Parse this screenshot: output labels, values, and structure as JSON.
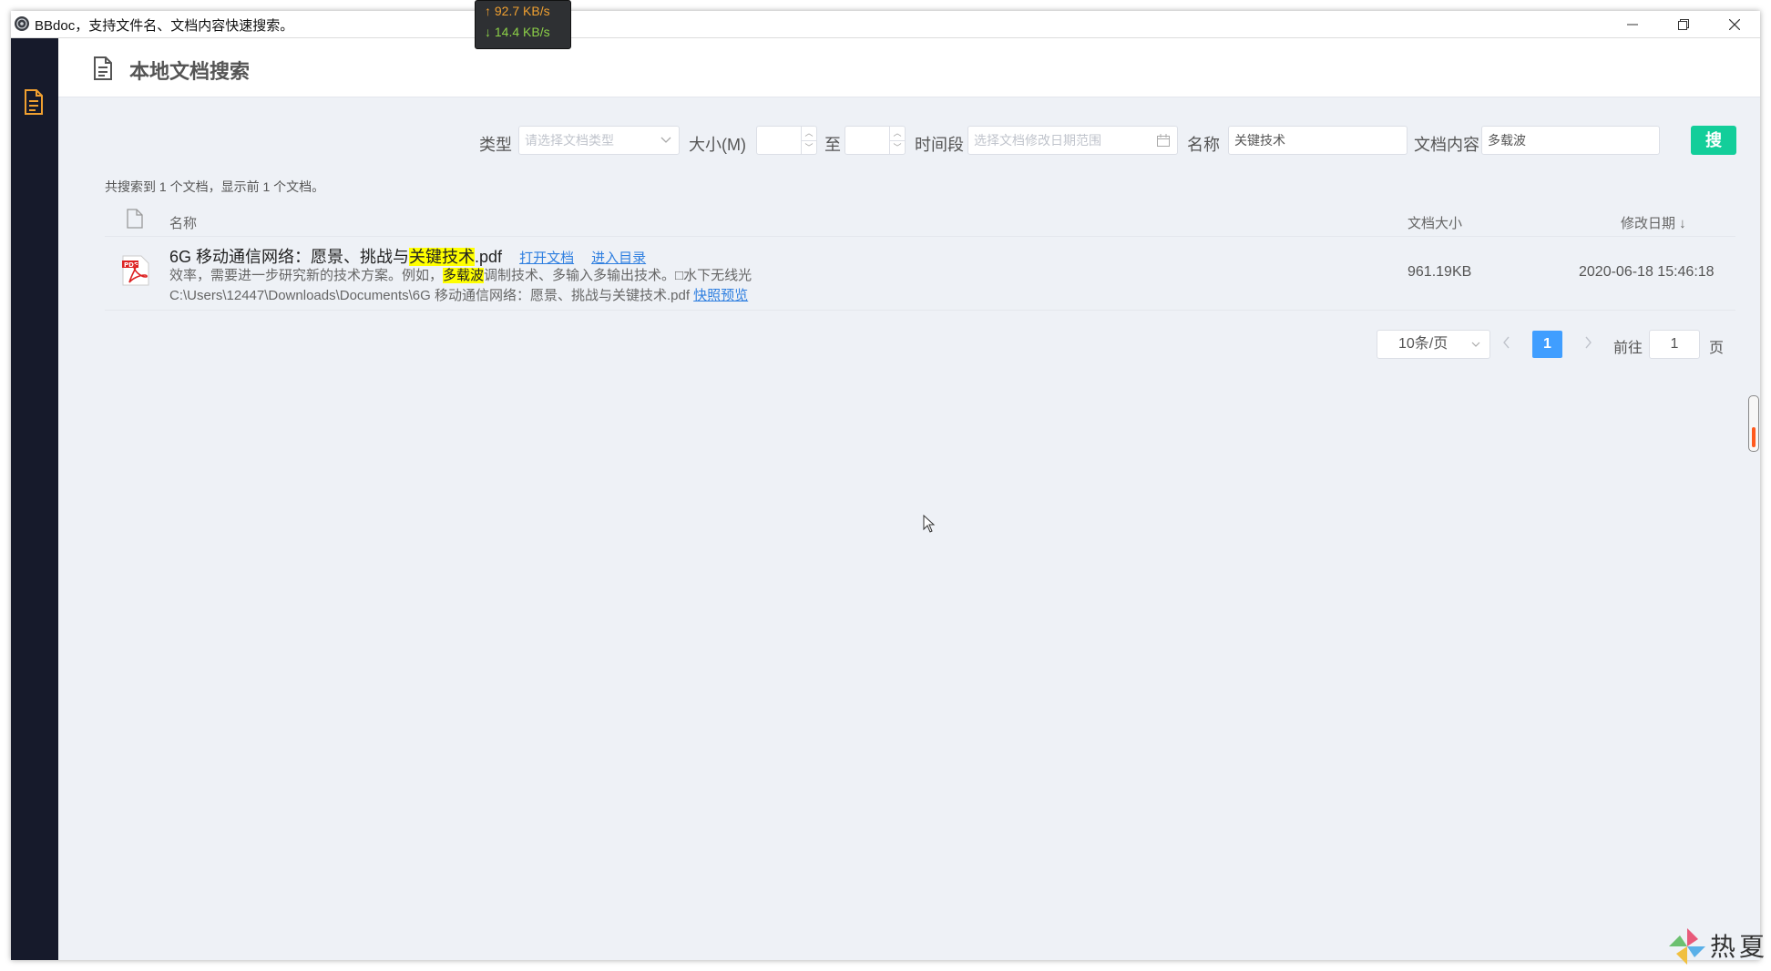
{
  "window": {
    "title": "BBdoc，支持文件名、文档内容快速搜索。"
  },
  "net_monitor": {
    "upload": "↑ 92.7 KB/s",
    "download": "↓ 14.4 KB/s",
    "colors": {
      "upload": "#f0a030",
      "download": "#8cd048"
    }
  },
  "sidebar": {
    "items": [
      {
        "icon": "document-icon",
        "active": true,
        "color": "#f0a030"
      }
    ]
  },
  "header": {
    "icon": "document-icon",
    "title": "本地文档搜索"
  },
  "filters": {
    "type_label": "类型",
    "type_placeholder": "请选择文档类型",
    "size_label": "大小(M)",
    "size_min": "",
    "size_to": "至",
    "size_max": "",
    "time_label": "时间段",
    "time_placeholder": "选择文档修改日期范围",
    "name_label": "名称",
    "name_value": "关键技术",
    "content_label": "文档内容",
    "content_value": "多载波",
    "search_button": "搜",
    "accent_color": "#13ce9a"
  },
  "summary": "共搜索到 1 个文档，显示前 1 个文档。",
  "table": {
    "columns": {
      "name": "名称",
      "size": "文档大小",
      "date": "修改日期 ↓"
    },
    "rows": [
      {
        "name_prefix": "6G 移动通信网络：愿景、挑战与",
        "name_highlight": "关键技术",
        "name_suffix": ".pdf",
        "open_link": "打开文档",
        "dir_link": "进入目录",
        "snippet_prefix": "效率，需要进一步研究新的技术方案。例如，",
        "snippet_highlight": "多载波",
        "snippet_suffix": "调制技术、多输入多输出技术。□水下无线光",
        "path": "C:\\Users\\12447\\Downloads\\Documents\\6G 移动通信网络：愿景、挑战与关键技术.pdf",
        "preview_link": "快照预览",
        "size": "961.19KB",
        "date": "2020-06-18 15:46:18"
      }
    ]
  },
  "pagination": {
    "page_size": "10条/页",
    "current_page": "1",
    "goto_label": "前往",
    "goto_value": "1",
    "page_suffix": "页",
    "active_color": "#409eff"
  },
  "watermark": {
    "text": "热夏"
  }
}
